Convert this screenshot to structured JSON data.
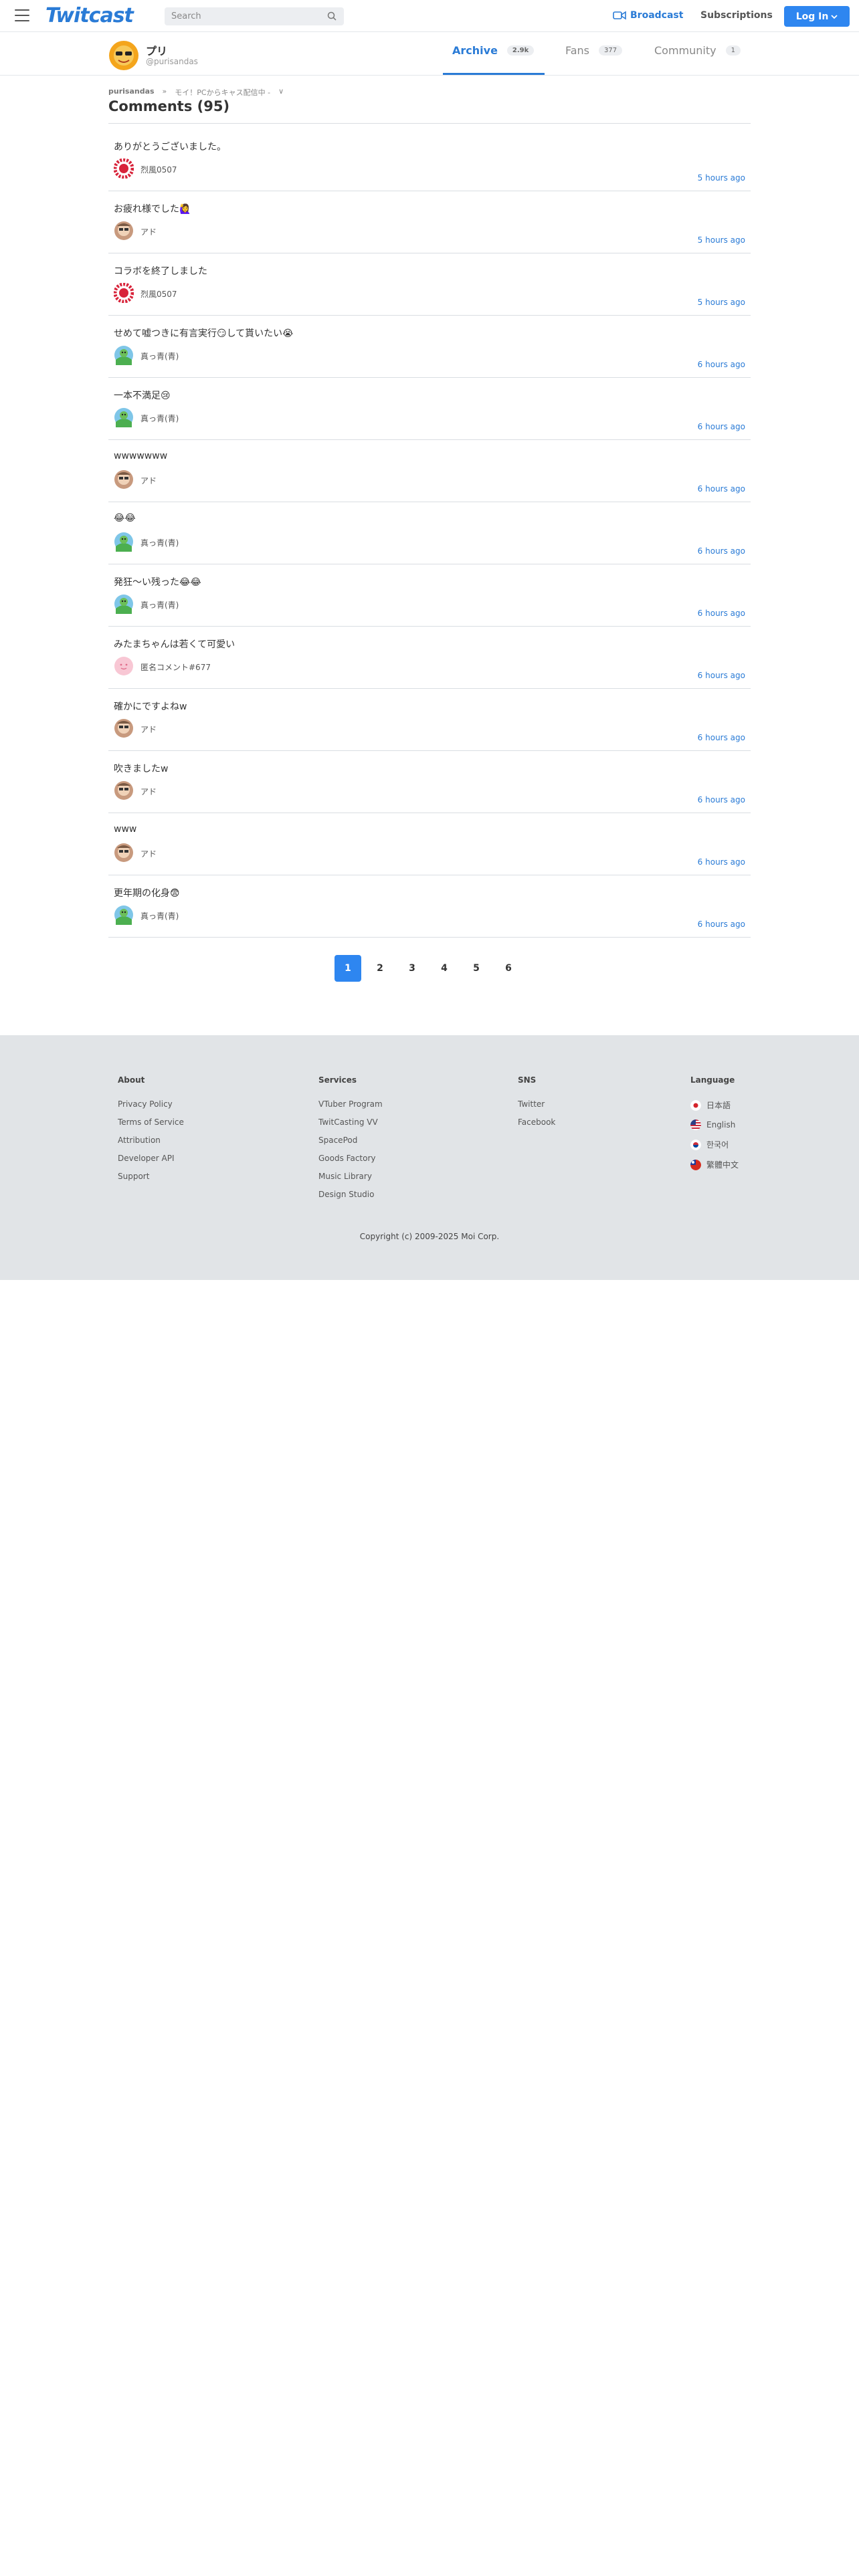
{
  "header": {
    "logo": "Twitcast",
    "search_placeholder": "Search",
    "broadcast": "Broadcast",
    "subscriptions": "Subscriptions",
    "login": "Log In"
  },
  "profile": {
    "name": "プリ",
    "id": "@purisandas",
    "tabs": [
      {
        "label": "Archive",
        "count": "2.9k",
        "active": true
      },
      {
        "label": "Fans",
        "count": "377",
        "active": false
      },
      {
        "label": "Community",
        "count": "1",
        "active": false
      }
    ]
  },
  "breadcrumb": {
    "user": "purisandas",
    "separator": "»",
    "movie": "モイ！PCからキャス配信中 -",
    "chevron": "∨"
  },
  "page_title": "Comments (95)",
  "comments": [
    {
      "text": "ありがとうございました。",
      "user": "烈風0507",
      "time": "5 hours ago",
      "avatar": "sun"
    },
    {
      "text": "お疲れ様でした🙋‍♀️",
      "user": "アド",
      "time": "5 hours ago",
      "avatar": "face"
    },
    {
      "text": "コラボを終了しました",
      "user": "烈風0507",
      "time": "5 hours ago",
      "avatar": "sun"
    },
    {
      "text": "せめて嘘つきに有言実行😏して貰いたい😭",
      "user": "真っ青(青)",
      "time": "6 hours ago",
      "avatar": "green"
    },
    {
      "text": "一本不満足😢",
      "user": "真っ青(青)",
      "time": "6 hours ago",
      "avatar": "green"
    },
    {
      "text": "wwwwwww",
      "user": "アド",
      "time": "6 hours ago",
      "avatar": "face"
    },
    {
      "text": "😂😂",
      "user": "真っ青(青)",
      "time": "6 hours ago",
      "avatar": "green"
    },
    {
      "text": "発狂〜い残った😂😂",
      "user": "真っ青(青)",
      "time": "6 hours ago",
      "avatar": "green"
    },
    {
      "text": "みたまちゃんは若くて可愛い",
      "user": "匿名コメント#677",
      "time": "6 hours ago",
      "avatar": "pink"
    },
    {
      "text": "確かにですよねw",
      "user": "アド",
      "time": "6 hours ago",
      "avatar": "face"
    },
    {
      "text": "吹きましたw",
      "user": "アド",
      "time": "6 hours ago",
      "avatar": "face"
    },
    {
      "text": "www",
      "user": "アド",
      "time": "6 hours ago",
      "avatar": "face"
    },
    {
      "text": "更年期の化身😨",
      "user": "真っ青(青)",
      "time": "6 hours ago",
      "avatar": "green"
    }
  ],
  "pagination": [
    "1",
    "2",
    "3",
    "4",
    "5",
    "6"
  ],
  "footer": {
    "about": {
      "title": "About",
      "links": [
        "Privacy Policy",
        "Terms of Service",
        "Attribution",
        "Developer API",
        "Support"
      ]
    },
    "services": {
      "title": "Services",
      "links": [
        "VTuber Program",
        "TwitCasting VV",
        "SpacePod",
        "Goods Factory",
        "Music Library",
        "Design Studio"
      ]
    },
    "sns": {
      "title": "SNS",
      "links": [
        "Twitter",
        "Facebook"
      ]
    },
    "language": {
      "title": "Language",
      "links": [
        "日本語",
        "English",
        "한국어",
        "繁體中文"
      ]
    },
    "copyright": "Copyright (c) 2009-2025 Moi Corp."
  },
  "colors": {
    "accent": "#2a7bd6",
    "button": "#2e86f0",
    "footer_bg": "#e1e4e7"
  }
}
